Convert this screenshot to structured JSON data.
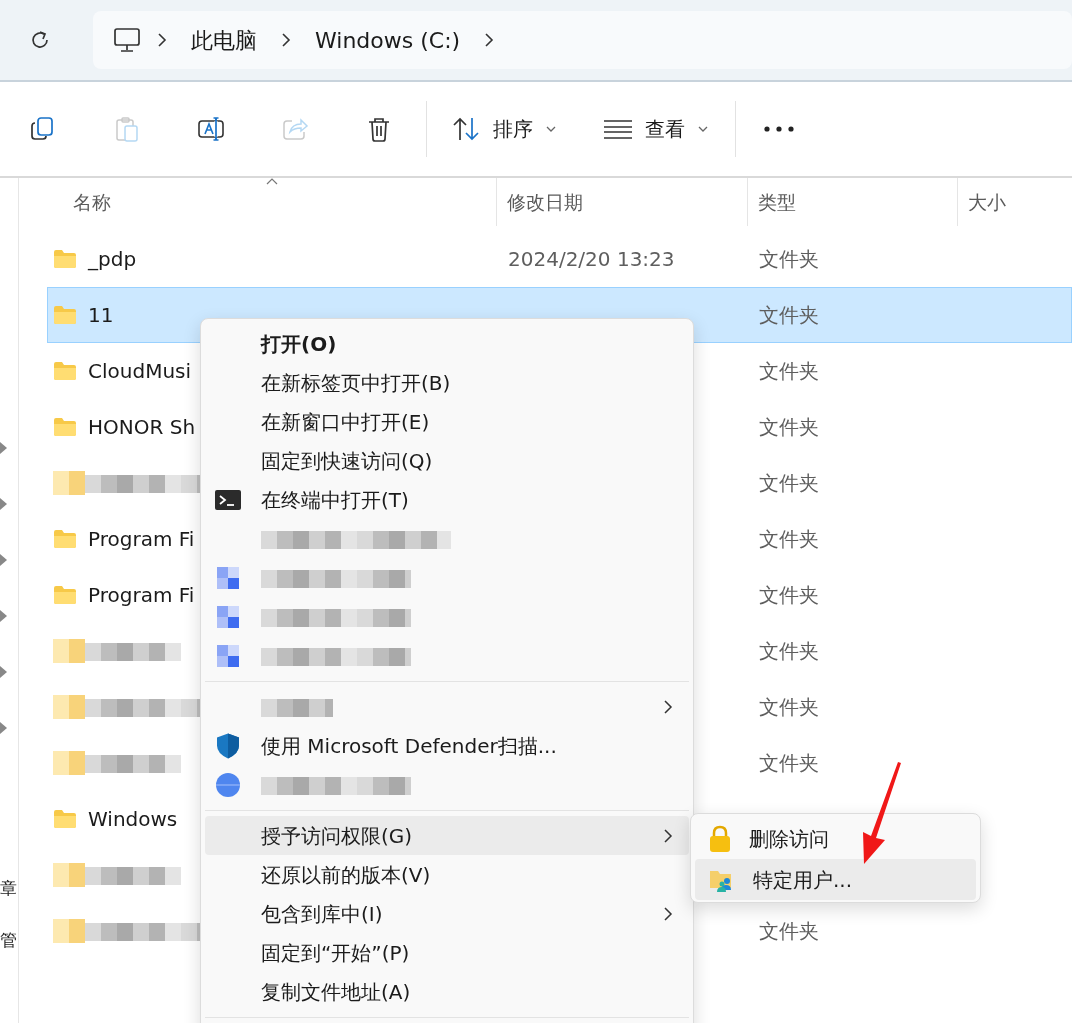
{
  "address_bar": {
    "crumbs": [
      {
        "label": "此电脑"
      },
      {
        "label": "Windows (C:)"
      }
    ]
  },
  "toolbar": {
    "actions": [
      {
        "kind": "copy",
        "disabled": false
      },
      {
        "kind": "paste",
        "disabled": true
      },
      {
        "kind": "rename",
        "disabled": false
      },
      {
        "kind": "share",
        "disabled": true
      },
      {
        "kind": "delete",
        "disabled": false
      }
    ],
    "sort": {
      "label": "排序"
    },
    "view": {
      "label": "查看"
    }
  },
  "sidebar": {
    "labels": [
      "章",
      "管"
    ]
  },
  "columns": [
    {
      "label": "名称",
      "sorted": true
    },
    {
      "label": "修改日期"
    },
    {
      "label": "类型"
    },
    {
      "label": "大小"
    }
  ],
  "rows": [
    {
      "kind": "folder",
      "name": "_pdp",
      "modified": "2024/2/20 13:23",
      "type": "文件夹",
      "selected": false
    },
    {
      "kind": "folder",
      "name": "11",
      "type": "文件夹",
      "selected": true
    },
    {
      "kind": "folder",
      "name": "CloudMusi",
      "type": "文件夹",
      "selected": false
    },
    {
      "kind": "folder",
      "name": "HONOR Sh",
      "type": "文件夹",
      "selected": false
    },
    {
      "kind": "blurred",
      "type": "文件夹",
      "selected": false
    },
    {
      "kind": "folder",
      "name": "Program Fi",
      "type": "文件夹",
      "selected": false
    },
    {
      "kind": "folder",
      "name": "Program Fi",
      "type": "文件夹",
      "selected": false
    },
    {
      "kind": "blurred",
      "type": "文件夹",
      "selected": false
    },
    {
      "kind": "blurred",
      "type": "文件夹",
      "selected": false
    },
    {
      "kind": "blurred",
      "type": "文件夹",
      "selected": false
    },
    {
      "kind": "folder",
      "name": "Windows",
      "selected": false
    },
    {
      "kind": "blurred",
      "selected": false
    },
    {
      "kind": "blurred",
      "type": "文件夹",
      "selected": false
    }
  ],
  "context_menu": {
    "items": [
      {
        "kind": "plain",
        "label": "打开(O)",
        "default": true
      },
      {
        "kind": "plain",
        "label": "在新标签页中打开(B)"
      },
      {
        "kind": "plain",
        "label": "在新窗口中打开(E)"
      },
      {
        "kind": "plain",
        "label": "固定到快速访问(Q)"
      },
      {
        "kind": "terminal",
        "label": "在终端中打开(T)"
      },
      {
        "kind": "blurred"
      },
      {
        "kind": "blurred-app"
      },
      {
        "kind": "blurred-app"
      },
      {
        "kind": "blurred-app"
      },
      {
        "kind": "separator"
      },
      {
        "kind": "blurred",
        "submenu": true
      },
      {
        "kind": "defender",
        "label": "使用 Microsoft Defender扫描..."
      },
      {
        "kind": "blurred-globe"
      },
      {
        "kind": "separator"
      },
      {
        "kind": "plain",
        "label": "授予访问权限(G)",
        "submenu": true,
        "selected": true
      },
      {
        "kind": "plain",
        "label": "还原以前的版本(V)"
      },
      {
        "kind": "plain",
        "label": "包含到库中(I)",
        "submenu": true
      },
      {
        "kind": "plain",
        "label": "固定到“开始”(P)"
      },
      {
        "kind": "plain",
        "label": "复制文件地址(A)"
      },
      {
        "kind": "separator"
      }
    ]
  },
  "submenu": {
    "items": [
      {
        "kind": "lock",
        "label": "删除访问",
        "selected": false
      },
      {
        "kind": "people",
        "label": "特定用户...",
        "selected": true
      }
    ]
  }
}
